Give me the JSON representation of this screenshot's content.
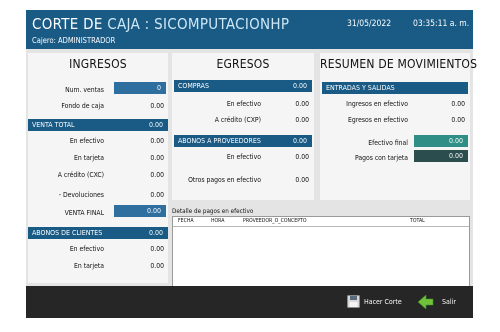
{
  "header": {
    "title_prefix": "CORTE DE",
    "title_accent": "CAJA : SICOMPUTACIONHP",
    "cajero": "Cajero: ADMINISTRADOR",
    "date": "31/05/2022",
    "time": "03:35:11 a. m."
  },
  "ingresos": {
    "title": "INGRESOS",
    "num_ventas_label": "Num. ventas",
    "num_ventas_value": "0",
    "fondo_label": "Fondo de caja",
    "fondo_value": "0.00",
    "venta_total": {
      "label": "VENTA TOTAL",
      "value": "0.00",
      "rows": [
        {
          "label": "En efectivo",
          "value": "0.00"
        },
        {
          "label": "En tarjeta",
          "value": "0.00"
        },
        {
          "label": "A crédito (CXC)",
          "value": "0.00"
        }
      ]
    },
    "devoluciones_label": "- Devoluciones",
    "devoluciones_value": "0.00",
    "venta_final_label": "VENTA FINAL",
    "venta_final_value": "0.00",
    "abonos_clientes": {
      "label": "ABONOS DE CLIENTES",
      "value": "0.00",
      "rows": [
        {
          "label": "En efectivo",
          "value": "0.00"
        },
        {
          "label": "En tarjeta",
          "value": "0.00"
        }
      ]
    }
  },
  "egresos": {
    "title": "EGRESOS",
    "compras": {
      "label": "COMPRAS",
      "value": "0.00",
      "rows": [
        {
          "label": "En efectivo",
          "value": "0.00"
        },
        {
          "label": "A crédito (CXP)",
          "value": "0.00"
        }
      ]
    },
    "abonos_proveedores": {
      "label": "ABONOS A PROVEEDORES",
      "value": "0.00",
      "rows": [
        {
          "label": "En efectivo",
          "value": "0.00"
        }
      ]
    },
    "otros_label": "Otros pagos en efectivo",
    "otros_value": "0.00"
  },
  "resumen": {
    "title": "RESUMEN DE MOVIMIENTOS",
    "entradas_label": "ENTRADAS Y SALIDAS",
    "ingresos_efectivo_label": "Ingresos en efectivo",
    "ingresos_efectivo_value": "0.00",
    "egresos_efectivo_label": "Egresos en efectivo",
    "egresos_efectivo_value": "0.00",
    "efectivo_final_label": "Efectivo final",
    "efectivo_final_value": "0.00",
    "pagos_tarjeta_label": "Pagos con tarjeta",
    "pagos_tarjeta_value": "0.00"
  },
  "detalle": {
    "caption": "Detalle de pagos en efectivo",
    "columns": [
      "FECHA",
      "HORA",
      "PROVEEDOR_O_CONCEPTO",
      "TOTAL"
    ]
  },
  "footer": {
    "hacer_corte_label": "Hacer Corte",
    "salir_label": "Salir"
  },
  "colors": {
    "header_bg": "#1a5b86",
    "footer_bg": "#262626",
    "efectivo_final_box": "#2f8f86",
    "pagos_tarjeta_box": "#2c4d4d"
  },
  "icons": [
    "floppy-disk-icon",
    "green-arrow-left-icon"
  ]
}
